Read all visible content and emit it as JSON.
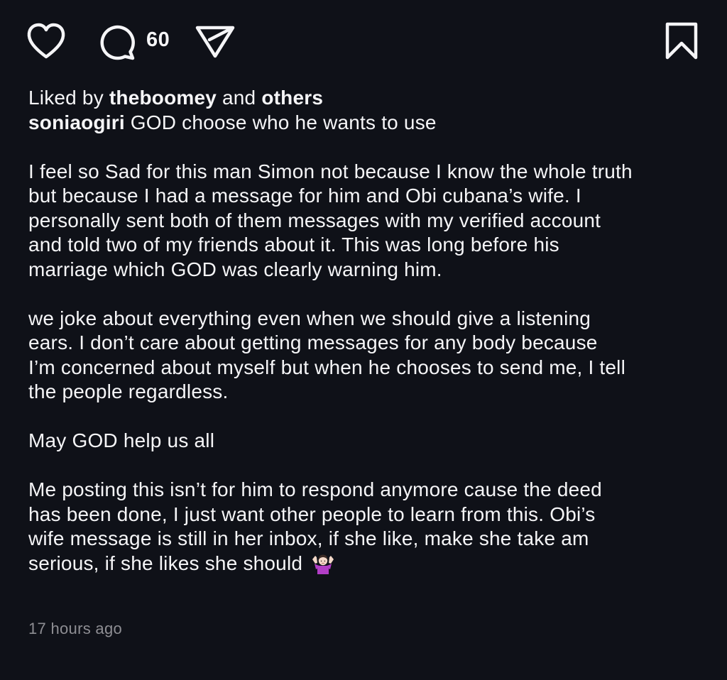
{
  "actions": {
    "comment_count": "60"
  },
  "likes": {
    "prefix": "Liked by",
    "user": "theboomey",
    "conjunction": "and",
    "others": "others"
  },
  "caption": {
    "username": "soniaogiri",
    "headline": "GOD choose who he wants to use",
    "paragraphs": [
      [
        "I feel so Sad for this man Simon not because I know the whole truth",
        "but because I had a message for him and Obi cubana’s wife. I",
        "personally sent both of them messages with my verified account",
        "and told two of my friends about it. This was long before his",
        "marriage which GOD was clearly warning him."
      ],
      [
        "we joke about everything even when we should give a listening",
        "ears.  I don’t care about getting messages for any body because",
        "I’m concerned about myself but when he chooses to send me, I tell",
        "the people regardless."
      ],
      [
        "May GOD help us all"
      ],
      [
        "Me posting this isn’t for him to respond anymore cause the deed",
        "has been done, I just want other people to learn from this. Obi’s",
        "wife message is still in her inbox, if she like, make she take am",
        "serious, if she likes she should"
      ]
    ],
    "trailing_emoji": "person-shrugging-emoji"
  },
  "timestamp": "17 hours ago",
  "colors": {
    "background": "#0f1118",
    "text": "#f5f5f7",
    "muted": "#8e8e93",
    "emoji_shirt": "#b23ec6"
  }
}
